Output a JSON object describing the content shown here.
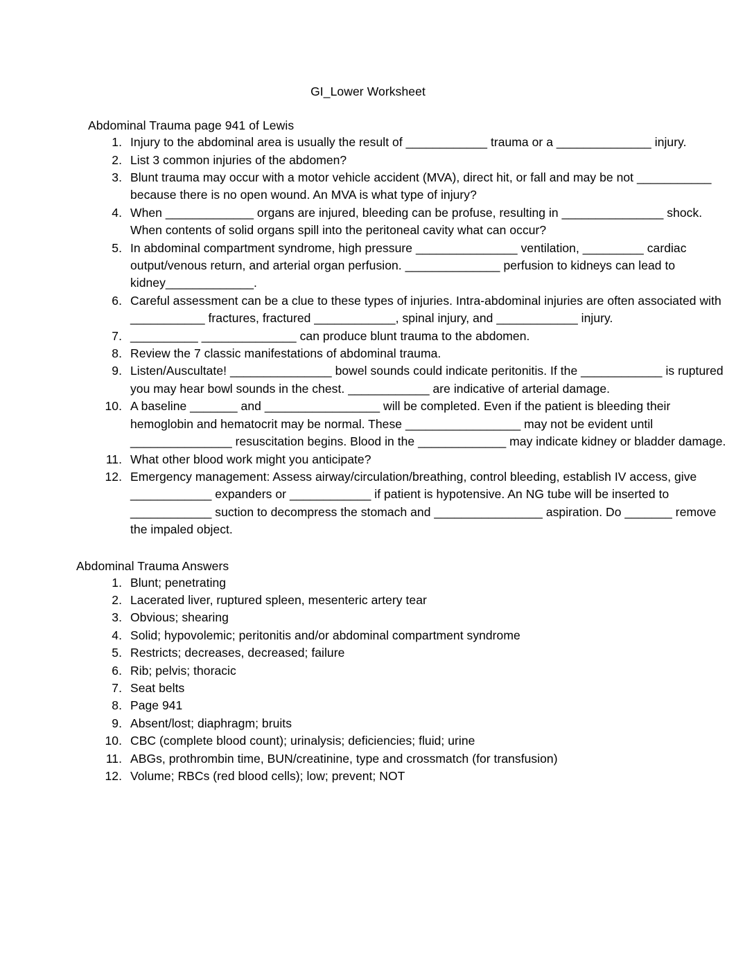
{
  "document": {
    "title": "GI_Lower Worksheet"
  },
  "sections": {
    "questions": {
      "heading": "Abdominal Trauma page 941 of Lewis",
      "items": [
        {
          "number": "1.",
          "text": "Injury to the abdominal area is usually the result of ____________ trauma or a ______________ injury."
        },
        {
          "number": "2.",
          "text": "List 3 common injuries of the abdomen?"
        },
        {
          "number": "3.",
          "text": "Blunt trauma may occur with a motor vehicle accident (MVA), direct hit, or fall and may be not ___________ because there is no open wound. An MVA is what type of injury?"
        },
        {
          "number": "4.",
          "text": "When _____________ organs are injured, bleeding can be profuse, resulting in _______________ shock. When contents of solid organs spill into the peritoneal cavity what can occur?"
        },
        {
          "number": "5.",
          "text": "In abdominal compartment syndrome, high pressure _______________ ventilation, _________ cardiac output/venous return, and arterial organ perfusion. ______________ perfusion to kidneys can lead to kidney_____________."
        },
        {
          "number": "6.",
          "text": "Careful assessment can be a clue to these types of injuries. Intra-abdominal injuries are often associated with ___________ fractures, fractured ____________, spinal injury, and ____________ injury."
        },
        {
          "number": "7.",
          "text": "__________ ______________ can produce blunt trauma to the abdomen."
        },
        {
          "number": "8.",
          "text": "Review the 7 classic manifestations of abdominal trauma."
        },
        {
          "number": "9.",
          "text": "Listen/Auscultate! _______________ bowel sounds could indicate peritonitis. If the ____________ is ruptured you may hear bowl sounds in the chest. ____________ are indicative of arterial damage."
        },
        {
          "number": "10.",
          "text": "A baseline _______ and _________________ will be completed. Even if the patient is bleeding their hemoglobin and hematocrit may be normal. These _________________ may not be evident until _______________ resuscitation begins. Blood in the _____________ may indicate kidney or bladder damage."
        },
        {
          "number": "11.",
          "text": "What other blood work might you anticipate?"
        },
        {
          "number": "12.",
          "text": "Emergency management: Assess airway/circulation/breathing, control bleeding, establish IV access, give ____________ expanders or ____________ if patient is hypotensive. An NG tube will be inserted to ____________ suction to decompress the stomach and ________________ aspiration. Do _______ remove the impaled object."
        }
      ]
    },
    "answers": {
      "heading": "Abdominal Trauma Answers",
      "items": [
        {
          "number": "1.",
          "text": "Blunt; penetrating"
        },
        {
          "number": "2.",
          "text": "Lacerated liver, ruptured spleen, mesenteric artery tear"
        },
        {
          "number": "3.",
          "text": "Obvious; shearing"
        },
        {
          "number": "4.",
          "text": "Solid; hypovolemic; peritonitis and/or abdominal compartment syndrome"
        },
        {
          "number": "5.",
          "text": "Restricts; decreases, decreased; failure"
        },
        {
          "number": "6.",
          "text": "Rib; pelvis; thoracic"
        },
        {
          "number": "7.",
          "text": "Seat belts"
        },
        {
          "number": "8.",
          "text": "Page 941"
        },
        {
          "number": "9.",
          "text": "Absent/lost; diaphragm; bruits"
        },
        {
          "number": "10.",
          "text": "CBC (complete blood count); urinalysis; deficiencies; fluid; urine"
        },
        {
          "number": "11.",
          "text": "ABGs, prothrombin time, BUN/creatinine, type and crossmatch (for transfusion)"
        },
        {
          "number": "12.",
          "text": "Volume; RBCs (red blood cells); low; prevent; NOT"
        }
      ]
    }
  },
  "colors": {
    "page_background": "#ffffff",
    "text": "#000000"
  }
}
